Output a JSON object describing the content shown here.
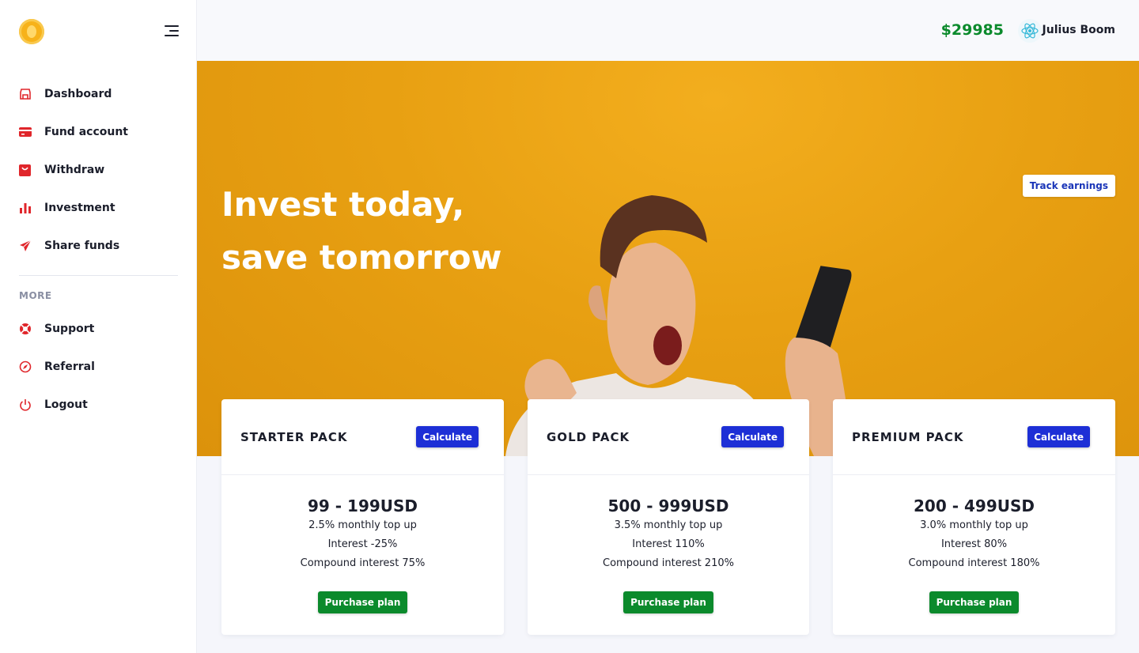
{
  "sidebar": {
    "items": [
      {
        "label": "Dashboard",
        "icon": "store-icon"
      },
      {
        "label": "Fund account",
        "icon": "card-icon"
      },
      {
        "label": "Withdraw",
        "icon": "bag-icon"
      },
      {
        "label": "Investment",
        "icon": "bar-chart-icon"
      },
      {
        "label": "Share funds",
        "icon": "send-icon"
      }
    ],
    "more_label": "MORE",
    "more_items": [
      {
        "label": "Support",
        "icon": "lifebuoy-icon"
      },
      {
        "label": "Referral",
        "icon": "compass-icon"
      },
      {
        "label": "Logout",
        "icon": "power-icon"
      }
    ]
  },
  "header": {
    "balance": "$29985",
    "username": "Julius Boom"
  },
  "hero": {
    "title": "Invest today, save tomorrow",
    "track_button": "Track earnings"
  },
  "plans": [
    {
      "name": "STARTER PACK",
      "calc": "Calculate",
      "price": "99 - 199USD",
      "topup": "2.5% monthly top up",
      "interest": "Interest -25%",
      "compound": "Compound interest 75%",
      "purchase": "Purchase plan"
    },
    {
      "name": "GOLD PACK",
      "calc": "Calculate",
      "price": "500 - 999USD",
      "topup": "3.5% monthly top up",
      "interest": "Interest 110%",
      "compound": "Compound interest 210%",
      "purchase": "Purchase plan"
    },
    {
      "name": "PREMIUM PACK",
      "calc": "Calculate",
      "price": "200 - 499USD",
      "topup": "3.0% monthly top up",
      "interest": "Interest 80%",
      "compound": "Compound interest 180%",
      "purchase": "Purchase plan"
    }
  ],
  "colors": {
    "accent_red": "#e0262b",
    "balance_green": "#0b8a2c",
    "calc_blue": "#1d2fd6",
    "hero_orange": "#e8a012"
  }
}
